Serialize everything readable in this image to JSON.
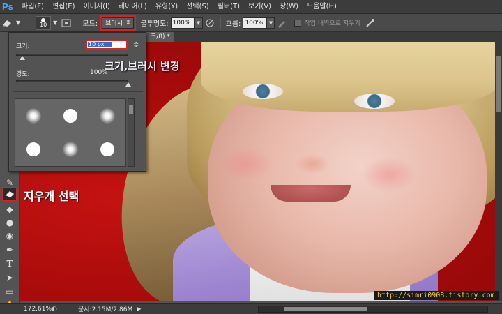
{
  "app": {
    "logo": "Ps"
  },
  "menubar": {
    "items": [
      "파일(F)",
      "편집(E)",
      "이미지(I)",
      "레이어(L)",
      "유형(Y)",
      "선택(S)",
      "필터(T)",
      "보기(V)",
      "창(W)",
      "도움말(H)"
    ]
  },
  "options": {
    "brush_size": "10",
    "mode_label": "모드:",
    "mode_value": "브러시",
    "opacity_label": "불투명도:",
    "opacity_value": "100%",
    "flow_label": "흐름:",
    "flow_value": "100%",
    "history_checkbox_label": "작업 내역으로 지우기"
  },
  "document": {
    "tab_label": "크/8) *"
  },
  "brush_panel": {
    "size_label": "크기:",
    "size_value": "10 px",
    "size_level": 0.05,
    "hardness_label": "경도:",
    "hardness_value": "100%",
    "hardness_level": 1.0,
    "tips": [
      "soft",
      "hard",
      "soft",
      "hard",
      "soft",
      "hard"
    ]
  },
  "annotations": {
    "brush_change": "크기,브러시 변경",
    "eraser_select": "지우개 선택",
    "watermark": "http://simri0908.tistory.com"
  },
  "status": {
    "zoom": "172.61%",
    "doc_info": "문서:2.15M/2.86M"
  },
  "tools": [
    "brush-icon",
    "eraser-icon",
    "paint-bucket-icon",
    "blur-icon",
    "dodge-icon",
    "pen-icon",
    "type-icon",
    "path-select-icon",
    "shape-icon",
    "hand-icon"
  ],
  "colors": {
    "accent_red": "#e02020",
    "canvas_bg": "#b00d0d",
    "watermark_text": "#f0d020"
  }
}
